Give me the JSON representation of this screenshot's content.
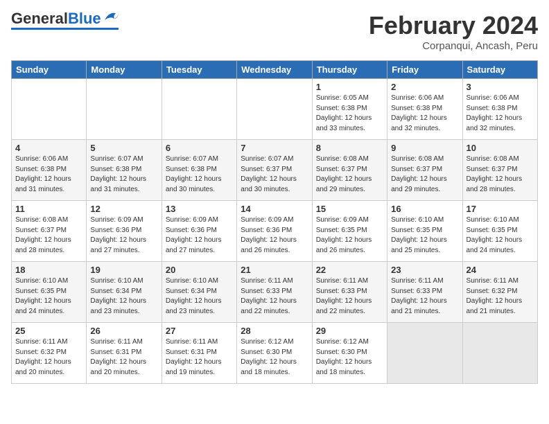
{
  "header": {
    "logo_general": "General",
    "logo_blue": "Blue",
    "main_title": "February 2024",
    "subtitle": "Corpanqui, Ancash, Peru"
  },
  "calendar": {
    "days_of_week": [
      "Sunday",
      "Monday",
      "Tuesday",
      "Wednesday",
      "Thursday",
      "Friday",
      "Saturday"
    ],
    "weeks": [
      [
        {
          "day": "",
          "info": ""
        },
        {
          "day": "",
          "info": ""
        },
        {
          "day": "",
          "info": ""
        },
        {
          "day": "",
          "info": ""
        },
        {
          "day": "1",
          "info": "Sunrise: 6:05 AM\nSunset: 6:38 PM\nDaylight: 12 hours\nand 33 minutes."
        },
        {
          "day": "2",
          "info": "Sunrise: 6:06 AM\nSunset: 6:38 PM\nDaylight: 12 hours\nand 32 minutes."
        },
        {
          "day": "3",
          "info": "Sunrise: 6:06 AM\nSunset: 6:38 PM\nDaylight: 12 hours\nand 32 minutes."
        }
      ],
      [
        {
          "day": "4",
          "info": "Sunrise: 6:06 AM\nSunset: 6:38 PM\nDaylight: 12 hours\nand 31 minutes."
        },
        {
          "day": "5",
          "info": "Sunrise: 6:07 AM\nSunset: 6:38 PM\nDaylight: 12 hours\nand 31 minutes."
        },
        {
          "day": "6",
          "info": "Sunrise: 6:07 AM\nSunset: 6:38 PM\nDaylight: 12 hours\nand 30 minutes."
        },
        {
          "day": "7",
          "info": "Sunrise: 6:07 AM\nSunset: 6:37 PM\nDaylight: 12 hours\nand 30 minutes."
        },
        {
          "day": "8",
          "info": "Sunrise: 6:08 AM\nSunset: 6:37 PM\nDaylight: 12 hours\nand 29 minutes."
        },
        {
          "day": "9",
          "info": "Sunrise: 6:08 AM\nSunset: 6:37 PM\nDaylight: 12 hours\nand 29 minutes."
        },
        {
          "day": "10",
          "info": "Sunrise: 6:08 AM\nSunset: 6:37 PM\nDaylight: 12 hours\nand 28 minutes."
        }
      ],
      [
        {
          "day": "11",
          "info": "Sunrise: 6:08 AM\nSunset: 6:37 PM\nDaylight: 12 hours\nand 28 minutes."
        },
        {
          "day": "12",
          "info": "Sunrise: 6:09 AM\nSunset: 6:36 PM\nDaylight: 12 hours\nand 27 minutes."
        },
        {
          "day": "13",
          "info": "Sunrise: 6:09 AM\nSunset: 6:36 PM\nDaylight: 12 hours\nand 27 minutes."
        },
        {
          "day": "14",
          "info": "Sunrise: 6:09 AM\nSunset: 6:36 PM\nDaylight: 12 hours\nand 26 minutes."
        },
        {
          "day": "15",
          "info": "Sunrise: 6:09 AM\nSunset: 6:35 PM\nDaylight: 12 hours\nand 26 minutes."
        },
        {
          "day": "16",
          "info": "Sunrise: 6:10 AM\nSunset: 6:35 PM\nDaylight: 12 hours\nand 25 minutes."
        },
        {
          "day": "17",
          "info": "Sunrise: 6:10 AM\nSunset: 6:35 PM\nDaylight: 12 hours\nand 24 minutes."
        }
      ],
      [
        {
          "day": "18",
          "info": "Sunrise: 6:10 AM\nSunset: 6:35 PM\nDaylight: 12 hours\nand 24 minutes."
        },
        {
          "day": "19",
          "info": "Sunrise: 6:10 AM\nSunset: 6:34 PM\nDaylight: 12 hours\nand 23 minutes."
        },
        {
          "day": "20",
          "info": "Sunrise: 6:10 AM\nSunset: 6:34 PM\nDaylight: 12 hours\nand 23 minutes."
        },
        {
          "day": "21",
          "info": "Sunrise: 6:11 AM\nSunset: 6:33 PM\nDaylight: 12 hours\nand 22 minutes."
        },
        {
          "day": "22",
          "info": "Sunrise: 6:11 AM\nSunset: 6:33 PM\nDaylight: 12 hours\nand 22 minutes."
        },
        {
          "day": "23",
          "info": "Sunrise: 6:11 AM\nSunset: 6:33 PM\nDaylight: 12 hours\nand 21 minutes."
        },
        {
          "day": "24",
          "info": "Sunrise: 6:11 AM\nSunset: 6:32 PM\nDaylight: 12 hours\nand 21 minutes."
        }
      ],
      [
        {
          "day": "25",
          "info": "Sunrise: 6:11 AM\nSunset: 6:32 PM\nDaylight: 12 hours\nand 20 minutes."
        },
        {
          "day": "26",
          "info": "Sunrise: 6:11 AM\nSunset: 6:31 PM\nDaylight: 12 hours\nand 20 minutes."
        },
        {
          "day": "27",
          "info": "Sunrise: 6:11 AM\nSunset: 6:31 PM\nDaylight: 12 hours\nand 19 minutes."
        },
        {
          "day": "28",
          "info": "Sunrise: 6:12 AM\nSunset: 6:30 PM\nDaylight: 12 hours\nand 18 minutes."
        },
        {
          "day": "29",
          "info": "Sunrise: 6:12 AM\nSunset: 6:30 PM\nDaylight: 12 hours\nand 18 minutes."
        },
        {
          "day": "",
          "info": ""
        },
        {
          "day": "",
          "info": ""
        }
      ]
    ]
  }
}
